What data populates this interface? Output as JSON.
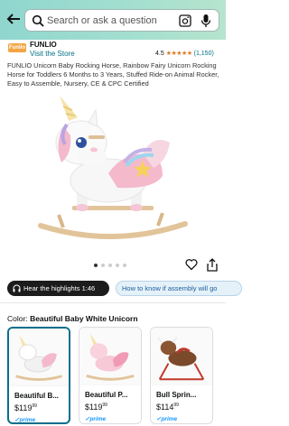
{
  "search": {
    "placeholder": "Search or ask a question"
  },
  "brand": {
    "logo_text": "Funlio",
    "name": "FUNLIO",
    "visit_link": "Visit the Store"
  },
  "rating": {
    "value": "4.5",
    "stars": "★★★★★",
    "count": "(1,150)"
  },
  "product": {
    "title": "FUNLIO Unicorn Baby Rocking Horse, Rainbow Fairy Unicorn Rocking Horse for Toddlers 6 Months to 3 Years, Stuffed Ride-on Animal Rocker, Easy to Assemble, Nursery, CE & CPC Certified"
  },
  "carousel": {
    "total": 5,
    "active": 0
  },
  "pills": {
    "highlights": "Hear the highlights 1:46",
    "assembly": "How to know if assembly will go"
  },
  "color": {
    "label": "Color:",
    "value": "Beautiful Baby White Unicorn"
  },
  "variants": [
    {
      "name": "Beautiful B...",
      "price_whole": "$119",
      "price_frac": "99",
      "prime": "✓prime"
    },
    {
      "name": "Beautiful P...",
      "price_whole": "$119",
      "price_frac": "99",
      "prime": "✓prime"
    },
    {
      "name": "Bull Sprin...",
      "price_whole": "$114",
      "price_frac": "99",
      "prime": "✓prime"
    }
  ],
  "colors": {
    "accent": "#007185",
    "star": "#de7921",
    "selected_border": "#0a6e8d"
  }
}
